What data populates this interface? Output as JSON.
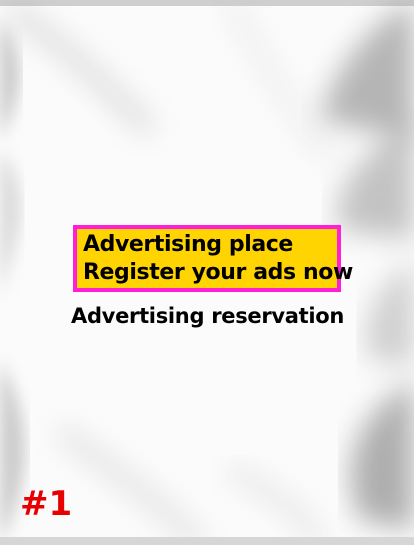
{
  "ad": {
    "line1": "Advertising place",
    "line2": "Register your ads now",
    "reservation": "Advertising reservation",
    "number": "#1"
  },
  "colors": {
    "box_fill": "#ffd400",
    "box_border": "#ff1fd6",
    "number_color": "#e80000"
  }
}
